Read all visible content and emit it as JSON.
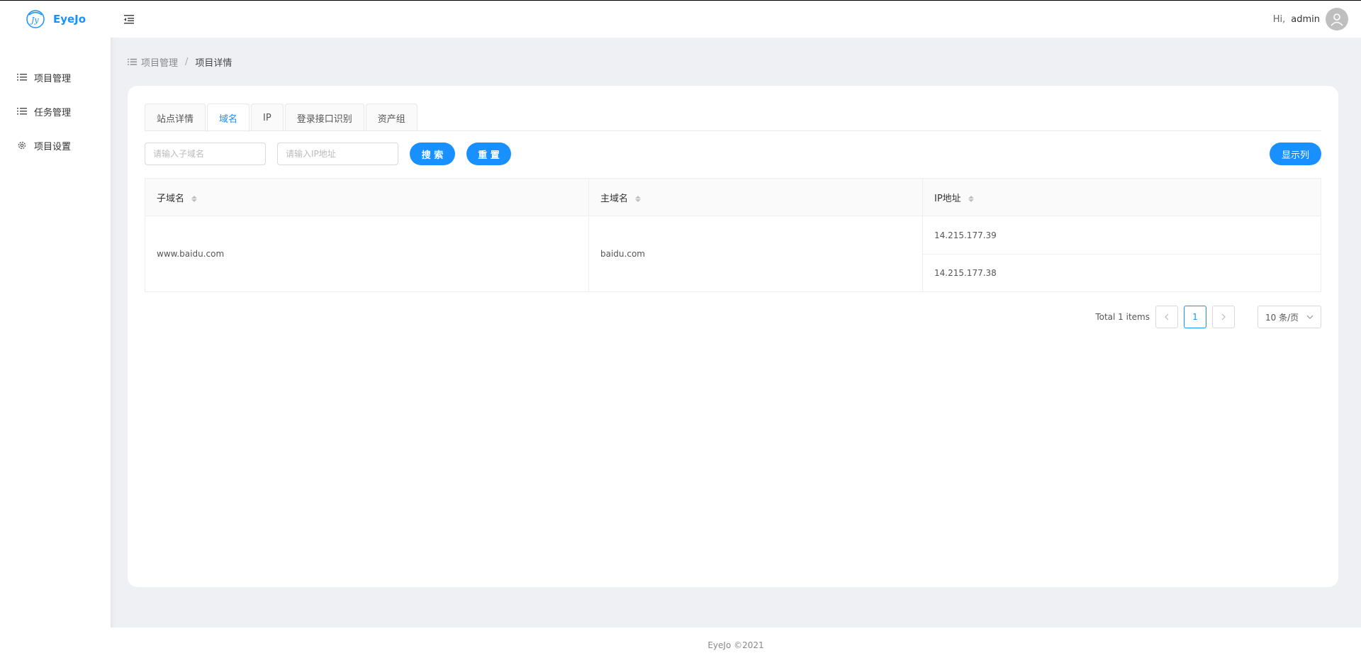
{
  "app": {
    "name": "EyeJo"
  },
  "sidebar": {
    "items": [
      {
        "label": "项目管理",
        "icon": "list-icon"
      },
      {
        "label": "任务管理",
        "icon": "list-icon"
      },
      {
        "label": "项目设置",
        "icon": "gear-icon"
      }
    ]
  },
  "header": {
    "greeting": "Hi,",
    "username": "admin"
  },
  "breadcrumb": {
    "parent": "项目管理",
    "separator": "/",
    "current": "项目详情"
  },
  "tabs": [
    {
      "label": "站点详情",
      "active": false
    },
    {
      "label": "域名",
      "active": true
    },
    {
      "label": "IP",
      "active": false
    },
    {
      "label": "登录接口识别",
      "active": false
    },
    {
      "label": "资产组",
      "active": false
    }
  ],
  "filters": {
    "subdomain_placeholder": "请输入子域名",
    "ip_placeholder": "请输入IP地址",
    "search_label": "搜 索",
    "reset_label": "重 置",
    "columns_label": "显示列"
  },
  "table": {
    "columns": [
      "子域名",
      "主域名",
      "IP地址"
    ],
    "rows": [
      {
        "subdomain": "www.baidu.com",
        "domain": "baidu.com",
        "ips": [
          "14.215.177.39",
          "14.215.177.38"
        ]
      }
    ]
  },
  "pagination": {
    "total_text": "Total 1 items",
    "current_page": "1",
    "page_size": "10 条/页"
  },
  "footer": {
    "text": "EyeJo ©2021"
  },
  "colors": {
    "accent": "#1890ff",
    "background": "#eef0f4"
  }
}
